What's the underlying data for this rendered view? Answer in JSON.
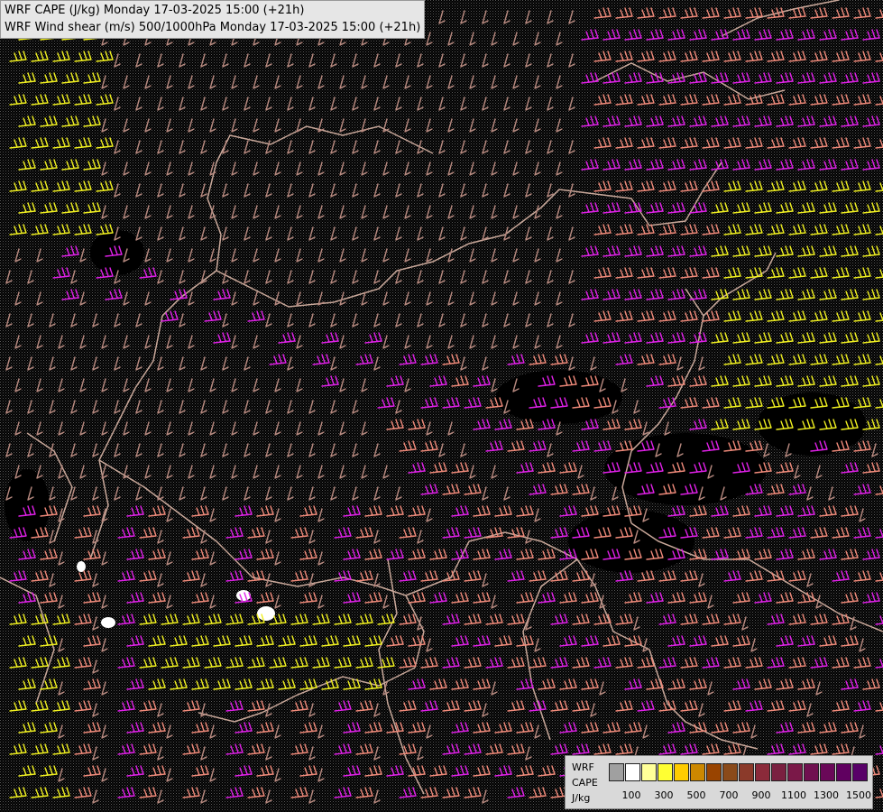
{
  "titles": [
    "WRF CAPE (J/kg) Monday 17-03-2025 15:00 (+21h)",
    "WRF Wind shear (m/s) 500/1000hPa Monday 17-03-2025 15:00 (+21h)"
  ],
  "legend": {
    "label_lines": [
      "WRF",
      "CAPE",
      "J/kg"
    ],
    "ticks": [
      "100",
      "300",
      "500",
      "700",
      "900",
      "1100",
      "1300",
      "1500"
    ],
    "colors": [
      "#a0a0a0",
      "#ffffff",
      "#ffff99",
      "#ffff33",
      "#ffcc00",
      "#cc8800",
      "#994400",
      "#8a4a1a",
      "#8b3a2a",
      "#8b2a3a",
      "#7a2040",
      "#7a1848",
      "#701050",
      "#6a0858",
      "#600060",
      "#580068"
    ]
  },
  "map_colors": {
    "background": "#000000",
    "stipple": "#5a5a5a",
    "borders": "#c9a89a",
    "rivers": "#3a6fb0",
    "barb_weak": "#b88a80",
    "barb_mid": "#f08a7a",
    "barb_strong": "#e020e8",
    "barb_extreme": "#f0f020"
  }
}
